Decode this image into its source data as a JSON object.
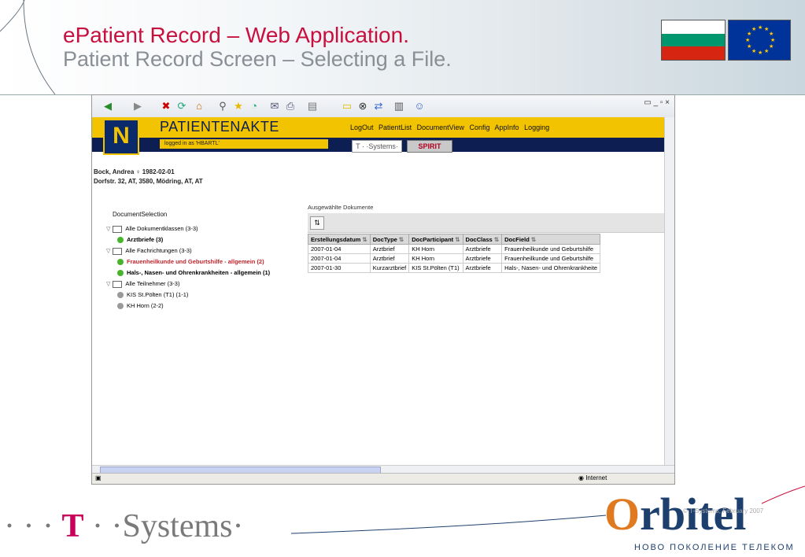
{
  "slide": {
    "title": "ePatient Record – Web Application.",
    "subtitle": "Patient Record Screen – Selecting a File."
  },
  "app": {
    "title": "PATIENTENAKTE",
    "logged_in": "logged in as 'HBARTL'",
    "logo_letter": "N",
    "menu": [
      "LogOut",
      "PatientList",
      "DocumentView",
      "Config",
      "AppInfo",
      "Logging"
    ],
    "tsys_badge": "T · ·Systems·",
    "spirit_badge": "SPIRIT"
  },
  "patient": {
    "name_dob": "Bock, Andrea ♀ 1982-02-01",
    "address": "Dorfstr. 32, AT, 3580, Mödring, AT, AT"
  },
  "document_selection": {
    "title": "DocumentSelection",
    "tree": [
      {
        "label": "Alle Dokumentklassen (3-3)",
        "type": "folder",
        "level": 0
      },
      {
        "label": "Arztbriefe (3)",
        "type": "green",
        "level": 1,
        "bold": true
      },
      {
        "label": "Alle Fachrichtungen (3-3)",
        "type": "folder",
        "level": 0
      },
      {
        "label": "Frauenheilkunde und Geburtshilfe - allgemein (2)",
        "type": "green",
        "level": 1,
        "bold": true,
        "color": "#c0252b"
      },
      {
        "label": "Hals-, Nasen- und Ohrenkrankheiten - allgemein (1)",
        "type": "green",
        "level": 1,
        "bold": true
      },
      {
        "label": "Alle Teilnehmer (3-3)",
        "type": "folder",
        "level": 0
      },
      {
        "label": "KIS St.Pölten (T1) (1-1)",
        "type": "grey",
        "level": 1
      },
      {
        "label": "KH Horn (2-2)",
        "type": "grey",
        "level": 1
      }
    ]
  },
  "documents": {
    "title": "Ausgewählte Dokumente",
    "columns": [
      "Erstellungsdatum",
      "DocType",
      "DocParticipant",
      "DocClass",
      "DocField"
    ],
    "rows": [
      [
        "2007-01-04",
        "Arztbrief",
        "KH Horn",
        "Arztbriefe",
        "Frauenheilkunde und Geburtshilfe"
      ],
      [
        "2007-01-04",
        "Arztbrief",
        "KH Horn",
        "Arztbriefe",
        "Frauenheilkunde und Geburtshilfe"
      ],
      [
        "2007-01-30",
        "Kurzarztbrief",
        "KIS St.Pölten (T1)",
        "Arztbriefe",
        "Hals-, Nasen- und Ohrenkrankheite"
      ]
    ]
  },
  "status": {
    "zone": "Internet"
  },
  "footer": {
    "tsys_t": "T",
    "tsys_rest": "Systems·",
    "orbitel_o": "O",
    "orbitel_rest": "rbitel",
    "orbitel_tag": "НОВО ПОКОЛЕНИЕ ТЕЛЕКОМ",
    "copyright": "© T-Systems, February 2007"
  },
  "colors": {
    "accent": "#c8103f",
    "app_yellow": "#f2c300",
    "app_navy": "#0d1f52"
  }
}
